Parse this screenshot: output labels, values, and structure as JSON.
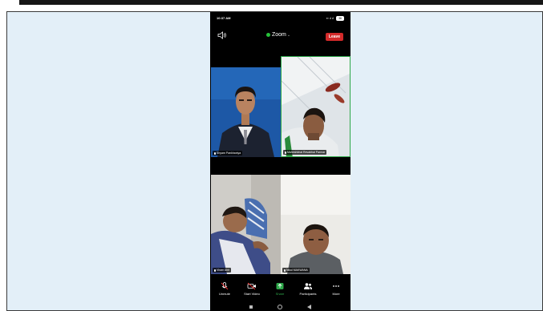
{
  "top_strip": {
    "tag": ""
  },
  "phone": {
    "status_time": "10:37 AM",
    "battery": "36"
  },
  "meeting": {
    "title": "Zoom",
    "leave_label": "Leave"
  },
  "participants": [
    {
      "name": "Shyam Pankhaniya"
    },
    {
      "name": "Maheshbhai Revabhai Parmar"
    },
    {
      "name": "Viram Ahir"
    },
    {
      "name": "Nikul MAKWANA"
    }
  ],
  "toolbar": {
    "unmute": "Unmute",
    "start_video": "Start Video",
    "share": "Share",
    "participants": "Participants",
    "more": "More"
  },
  "icons": {
    "speaker": "speaker-icon",
    "mic_muted": "mic-muted-icon",
    "video_off": "video-off-icon",
    "share": "share-screen-icon",
    "participants": "participants-icon",
    "more": "more-dots-icon"
  },
  "colors": {
    "leave": "#d32a2a",
    "share": "#2ea84a",
    "secure": "#26c23a",
    "cell_background": "#e3eff8"
  }
}
